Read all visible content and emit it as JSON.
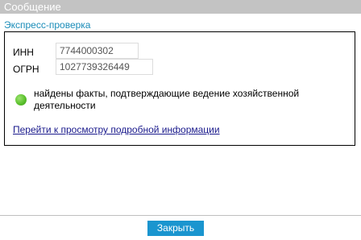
{
  "window": {
    "title": "Сообщение"
  },
  "section": {
    "title": "Экспресс-проверка"
  },
  "fields": {
    "inn": {
      "label": "ИНН",
      "value": "7744000302"
    },
    "ogrn": {
      "label": "ОГРН",
      "value": "1027739326449"
    }
  },
  "status": {
    "indicator_color": "#5cc12e",
    "icon": "green-circle-icon",
    "text": "найдены факты, подтверждающие ведение хозяйственной деятельности"
  },
  "details_link": {
    "label": "Перейти к просмотру подробной информации"
  },
  "footer": {
    "close_label": "Закрыть",
    "button_color": "#1a95cf"
  }
}
